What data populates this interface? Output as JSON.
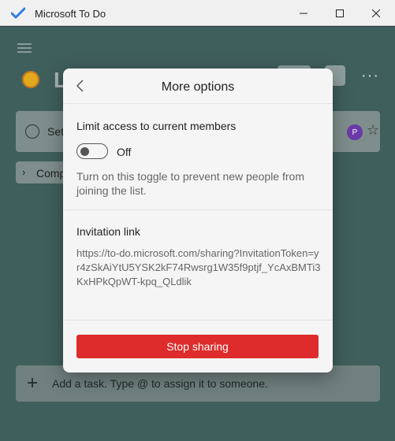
{
  "window": {
    "title": "Microsoft To Do",
    "accent": "#2f7de0"
  },
  "background": {
    "list_title": "L",
    "task_text": "Set",
    "avatar_initial": "P",
    "completed_label": "Comp",
    "add_task_placeholder": "Add a task. Type @ to assign it to someone."
  },
  "modal": {
    "title": "More options",
    "limit_access_label": "Limit access to current members",
    "toggle_state": "Off",
    "toggle_on": false,
    "toggle_description": "Turn on this toggle to prevent new people from joining the list.",
    "invitation_label": "Invitation link",
    "invitation_link": "https://to-do.microsoft.com/sharing?InvitationToken=yr4zSkAiYtU5YSK2kF74Rwsrg1W35f9ptjf_YcAxBMTi3KxHPkQpWT-kpq_QLdlik",
    "stop_sharing_label": "Stop sharing",
    "stop_color": "#de2b2b"
  }
}
